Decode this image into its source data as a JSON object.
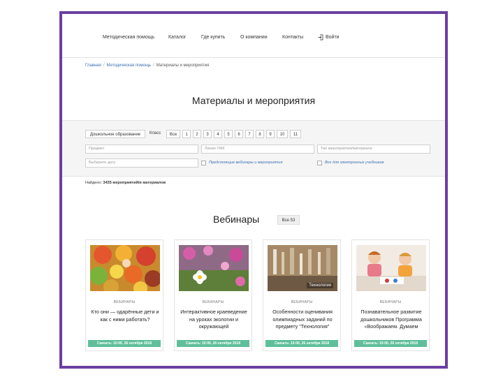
{
  "nav": {
    "items": [
      "Методическая помощь",
      "Каталог",
      "Где купить",
      "О компании",
      "Контакты"
    ],
    "login": "Войти"
  },
  "breadcrumbs": [
    "Главная",
    "Методическая помощь",
    "Материалы и мероприятия"
  ],
  "page": {
    "title": "Материалы и мероприятия"
  },
  "filters": {
    "level": "Дошкольное образование",
    "class_label": "Класс",
    "classes": [
      "Все",
      "1",
      "2",
      "3",
      "4",
      "5",
      "6",
      "7",
      "8",
      "9",
      "10",
      "11"
    ],
    "subject_placeholder": "Предмет",
    "line_placeholder": "Линия УМК",
    "type_placeholder": "Тип мероприятия/материала",
    "date_placeholder": "Выберите дату",
    "check_webinars": "Предстоящие вебинары и мероприятия",
    "check_ebooks": "Все для электронных учебников"
  },
  "results": {
    "prefix": "Найдено:",
    "count": "3435 мероприятий/и материалов"
  },
  "webinars": {
    "title": "Вебинары",
    "all_label": "Все 53",
    "cards": [
      {
        "tag": "ВЕБИНАРЫ",
        "title": "Кто они — одарённые дети и как с ними работать?",
        "badge": "Скачать: 15:00, 26 октября 2018"
      },
      {
        "tag": "ВЕБИНАРЫ",
        "title": "Интерактивное краеведение на уроках экологии и окружающей",
        "badge": "Скачать: 15:00, 26 октября 2018"
      },
      {
        "tag": "ВЕБИНАРЫ",
        "title": "Особенности оценивания олимпиадных заданий по предмету \"Технология\"",
        "badge": "Скачать: 15:00, 26 октября 2018",
        "image_caption": "Технология"
      },
      {
        "tag": "ВЕБИНАРЫ",
        "title": "Познавательное развитие дошкольников Программа «Воображаем. Думаем",
        "badge": "Скачать: 15:00, 26 октября 2018"
      }
    ]
  },
  "colors": {
    "frame": "#6b3fa0",
    "accent_badge": "#5fbf9a",
    "link": "#3a6fb0"
  }
}
